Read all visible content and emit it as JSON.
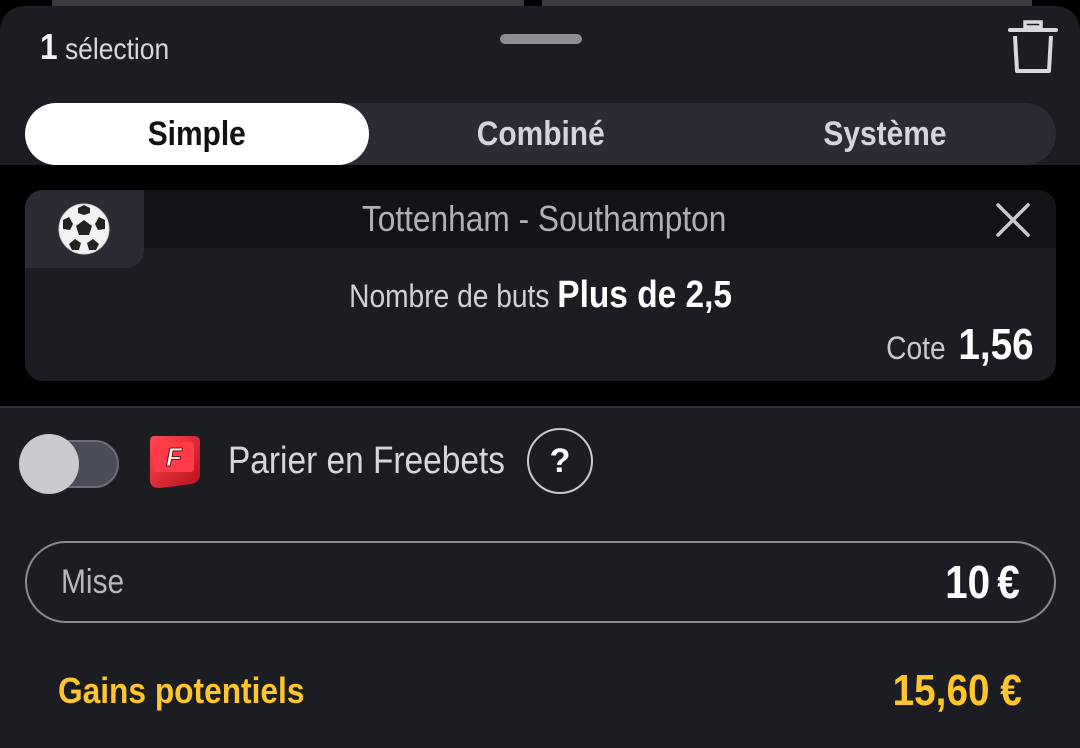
{
  "header": {
    "count": "1",
    "count_label": "sélection"
  },
  "tabs": [
    {
      "label": "Simple",
      "active": true
    },
    {
      "label": "Combiné",
      "active": false
    },
    {
      "label": "Système",
      "active": false
    }
  ],
  "bet": {
    "sport_icon": "soccer-ball-icon",
    "match": "Tottenham - Southampton",
    "market": "Nombre de buts",
    "selection": "Plus de 2,5",
    "odds_label": "Cote",
    "odds": "1,56"
  },
  "freebet": {
    "toggle_on": false,
    "logo_letter": "F",
    "label": "Parier en Freebets",
    "help": "?"
  },
  "stake": {
    "label": "Mise",
    "value": "10",
    "currency": "€"
  },
  "gains": {
    "label": "Gains potentiels",
    "value": "15,60 €"
  },
  "colors": {
    "background": "#1c1d22",
    "accent": "#ffc52a",
    "active_tab": "#ffffff"
  }
}
